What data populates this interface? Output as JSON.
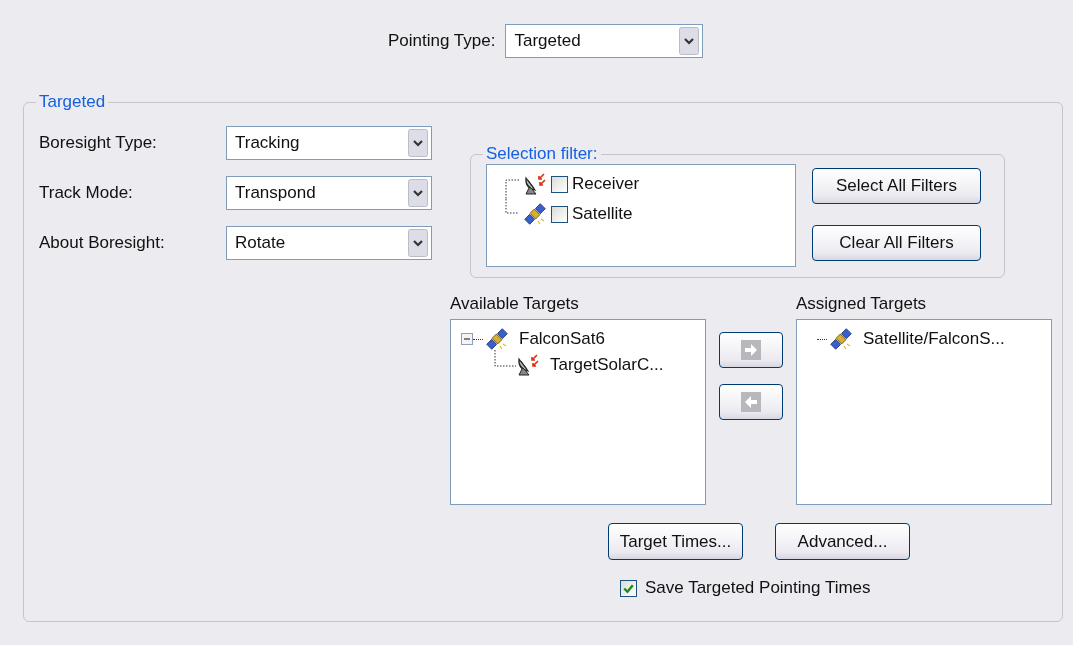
{
  "pointing_type": {
    "label": "Pointing Type:",
    "value": "Targeted"
  },
  "group": {
    "title": "Targeted"
  },
  "fields": [
    {
      "label": "Boresight Type:",
      "value": "Tracking"
    },
    {
      "label": "Track Mode:",
      "value": "Transpond"
    },
    {
      "label": "About Boresight:",
      "value": "Rotate"
    }
  ],
  "selection_filter": {
    "title": "Selection filter:",
    "items": [
      {
        "label": "Receiver",
        "kind": "receiver",
        "checked": false
      },
      {
        "label": "Satellite",
        "kind": "satellite",
        "checked": false
      }
    ],
    "buttons": [
      "Select All Filters",
      "Clear All Filters"
    ]
  },
  "available_targets": {
    "title": "Available Targets",
    "items": [
      {
        "label": "FalconSat6",
        "kind": "satellite",
        "expanded": true,
        "children": [
          {
            "label": "TargetSolarC...",
            "kind": "receiver"
          }
        ]
      }
    ]
  },
  "move_buttons": [
    {
      "kind": "assign",
      "disabled": true
    },
    {
      "kind": "unassign",
      "disabled": true
    }
  ],
  "assigned_targets": {
    "title": "Assigned Targets",
    "items": [
      {
        "label": "Satellite/FalconS...",
        "kind": "satellite"
      }
    ]
  },
  "buttons": [
    "Target Times...",
    "Advanced..."
  ],
  "save_times": {
    "label": "Save Targeted Pointing Times",
    "checked": true
  }
}
